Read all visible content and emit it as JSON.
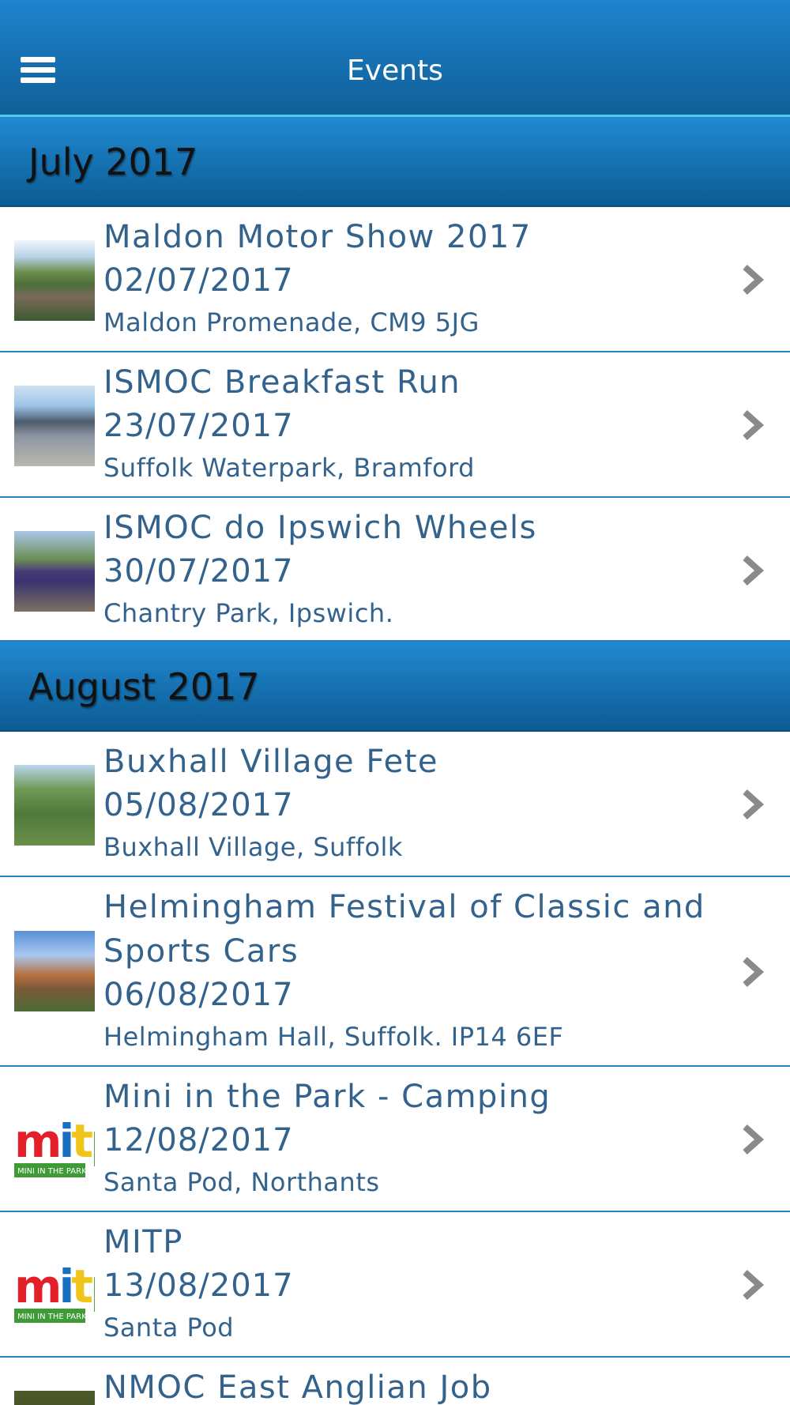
{
  "app_bar": {
    "title": "Events"
  },
  "sections": [
    {
      "label": "July 2017"
    },
    {
      "label": "August 2017"
    }
  ],
  "events": [
    {
      "title": "Maldon Motor Show 2017",
      "date": "02/07/2017",
      "location": "Maldon Promenade, CM9 5JG",
      "thumbnail": "car-show-photo"
    },
    {
      "title": "ISMOC Breakfast Run",
      "date": "23/07/2017",
      "location": "Suffolk Waterpark, Bramford",
      "thumbnail": "building-photo"
    },
    {
      "title": "ISMOC do Ipswich Wheels",
      "date": "30/07/2017",
      "location": "Chantry Park, Ipswich.",
      "thumbnail": "monster-truck-photo"
    },
    {
      "title": "Buxhall Village Fete",
      "date": "05/08/2017",
      "location": "Buxhall Village, Suffolk",
      "thumbnail": "fete-photo"
    },
    {
      "title": "Helmingham Festival of Classic and Sports Cars",
      "date": "06/08/2017",
      "location": "Helmingham Hall, Suffolk. IP14 6EF",
      "thumbnail": "hall-photo"
    },
    {
      "title": "Mini in the Park - Camping",
      "date": "12/08/2017",
      "location": "Santa Pod, Northants",
      "thumbnail": "mitp-logo"
    },
    {
      "title": "MITP",
      "date": "13/08/2017",
      "location": "Santa Pod",
      "thumbnail": "mitp-logo"
    },
    {
      "title": "NMOC East Anglian Job",
      "date": "",
      "location": "",
      "thumbnail": "event-photo"
    }
  ],
  "logo": {
    "letters": "mitp",
    "subtitle": "MINI IN THE PARK"
  },
  "colors": {
    "header_top": "#1e84cd",
    "header_bottom": "#0f5f98",
    "text": "#33638d",
    "divider": "#2a7fc0",
    "chevron": "#8a8a8a"
  }
}
